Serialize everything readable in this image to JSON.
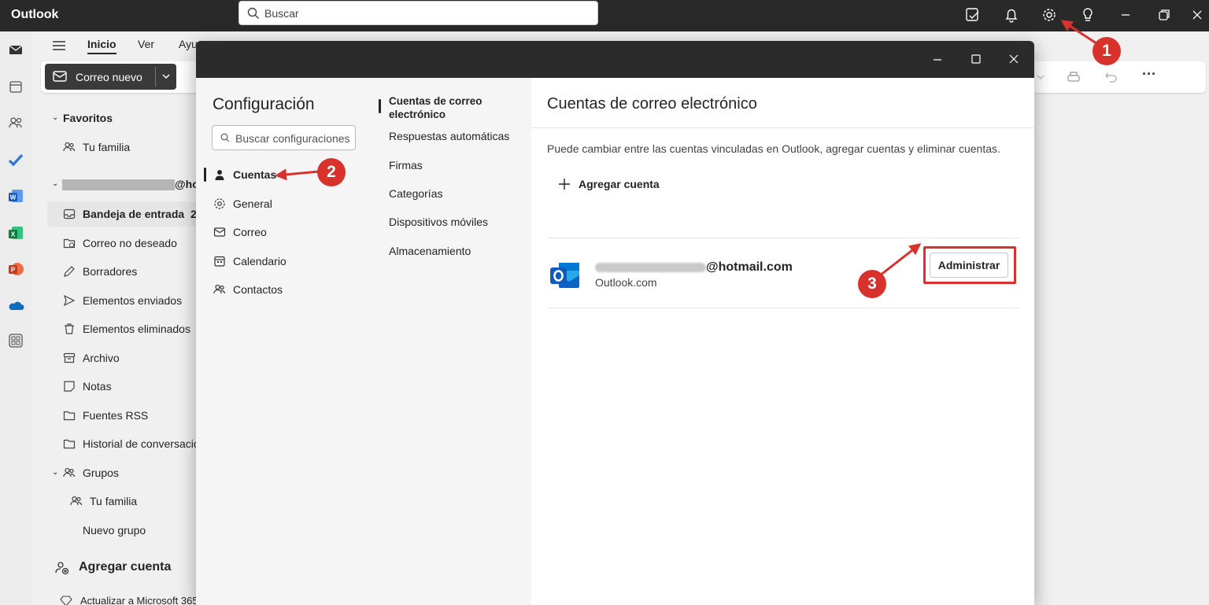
{
  "app": {
    "name": "Outlook"
  },
  "search": {
    "placeholder": "Buscar"
  },
  "ribbon": {
    "tabs": [
      "Inicio",
      "Ver",
      "Ayu"
    ],
    "new_mail": "Correo nuevo"
  },
  "folders": {
    "favorites_header": "Favoritos",
    "favorites": [
      "Tu familia"
    ],
    "account_suffix": "@ho",
    "items": [
      {
        "label": "Bandeja de entrada",
        "count": "2"
      },
      {
        "label": "Correo no deseado"
      },
      {
        "label": "Borradores"
      },
      {
        "label": "Elementos enviados"
      },
      {
        "label": "Elementos eliminados"
      },
      {
        "label": "Archivo"
      },
      {
        "label": "Notas"
      },
      {
        "label": "Fuentes RSS"
      },
      {
        "label": "Historial de conversacio"
      }
    ],
    "groups_header": "Grupos",
    "groups": [
      "Tu familia",
      "Nuevo grupo"
    ],
    "add_account": "Agregar cuenta",
    "upgrade": "Actualizar a Microsoft 365"
  },
  "settings": {
    "title": "Configuración",
    "search_placeholder": "Buscar configuraciones",
    "categories": [
      "Cuentas",
      "General",
      "Correo",
      "Calendario",
      "Contactos"
    ],
    "subcategories": [
      "Cuentas de correo electrónico",
      "Respuestas automáticas",
      "Firmas",
      "Categorías",
      "Dispositivos móviles",
      "Almacenamiento"
    ],
    "main": {
      "title": "Cuentas de correo electrónico",
      "description": "Puede cambiar entre las cuentas vinculadas en Outlook, agregar cuentas y eliminar cuentas.",
      "add_account": "Agregar cuenta",
      "account": {
        "email_domain": "@hotmail.com",
        "provider": "Outlook.com",
        "manage_button": "Administrar"
      }
    }
  },
  "annotations": [
    "1",
    "2",
    "3"
  ],
  "colors": {
    "annotation": "#d9322d",
    "titlebar": "#292929",
    "outlook_blue": "#0f6cbd"
  }
}
